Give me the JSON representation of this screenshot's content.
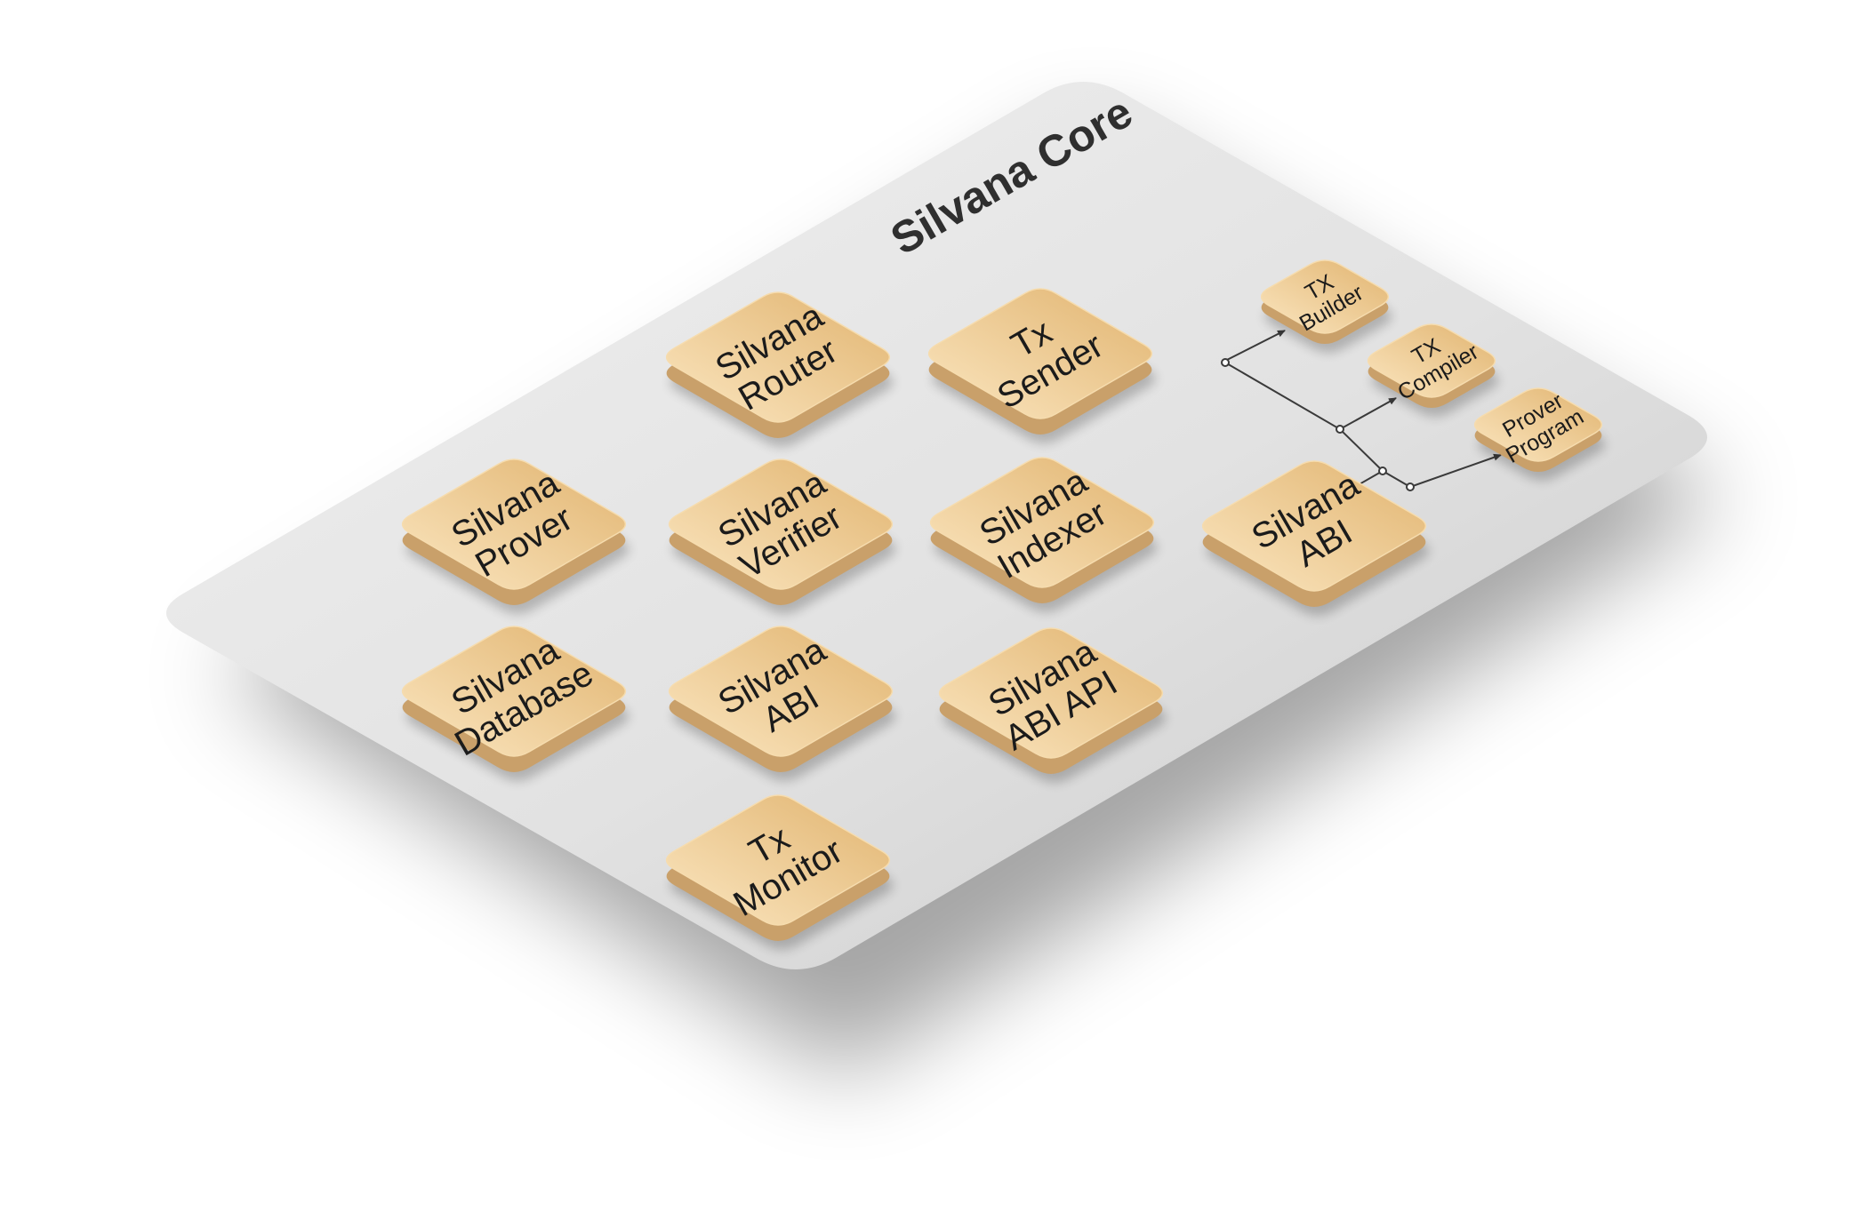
{
  "platform": {
    "title": "Silvana Core"
  },
  "modules": [
    {
      "id": "router",
      "lines": [
        "Silvana",
        "Router"
      ]
    },
    {
      "id": "sender",
      "lines": [
        "Tx",
        "Sender"
      ]
    },
    {
      "id": "prover",
      "lines": [
        "Silvana",
        "Prover"
      ]
    },
    {
      "id": "verifier",
      "lines": [
        "Silvana",
        "Verifier"
      ]
    },
    {
      "id": "indexer",
      "lines": [
        "Silvana",
        "Indexer"
      ]
    },
    {
      "id": "abi_main",
      "lines": [
        "Silvana",
        "ABI"
      ]
    },
    {
      "id": "database",
      "lines": [
        "Silvana",
        "Database"
      ]
    },
    {
      "id": "abi",
      "lines": [
        "Silvana",
        "ABI"
      ]
    },
    {
      "id": "abi_api",
      "lines": [
        "Silvana",
        "ABI API"
      ]
    },
    {
      "id": "monitor",
      "lines": [
        "Tx",
        "Monitor"
      ]
    }
  ],
  "submodules": [
    {
      "id": "tx_builder",
      "lines": [
        "TX",
        "Builder"
      ]
    },
    {
      "id": "tx_compiler",
      "lines": [
        "TX",
        "Compiler"
      ]
    },
    {
      "id": "prover_program",
      "lines": [
        "Prover",
        "Program"
      ]
    }
  ],
  "connections": [
    {
      "from": "abi_main",
      "to": "tx_builder"
    },
    {
      "from": "abi_main",
      "to": "tx_compiler"
    },
    {
      "from": "abi_main",
      "to": "prover_program"
    }
  ],
  "colors": {
    "platform_top": "#ebebeb",
    "platform_bottom": "#cdcdcd",
    "tile_light": "#f8dfb4",
    "tile_dark": "#e2b774",
    "tile_side": "#c9a06a",
    "connector": "#3a3a3a"
  }
}
